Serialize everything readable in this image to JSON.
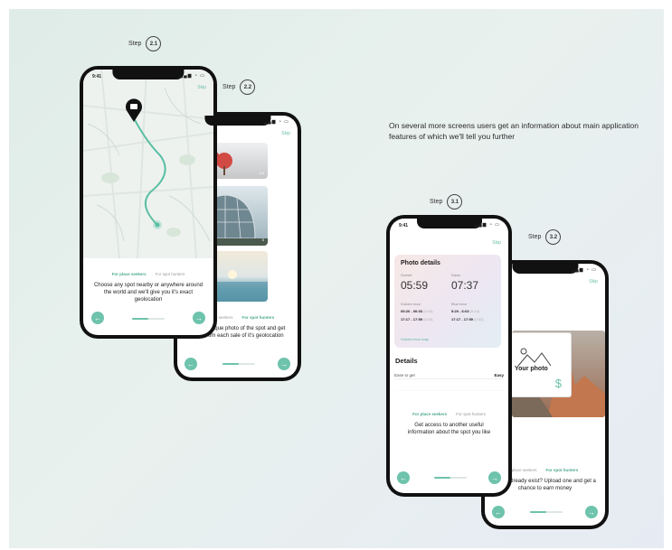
{
  "headline": "On several more screens users get an information about main application features of which we'll tell you further",
  "steps": {
    "s21": {
      "word": "Step",
      "num": "2.1"
    },
    "s22": {
      "word": "Step",
      "num": "2.2"
    },
    "s31": {
      "word": "Step",
      "num": "3.1"
    },
    "s32": {
      "word": "Step",
      "num": "3.2"
    }
  },
  "phone_a": {
    "time": "9:41",
    "skip": "Skip",
    "tab_active": "For place seekers",
    "tab_other": "For spot hunters",
    "text": "Choose any spot nearby or anywhere around the world and we'll give you it's exact geolocation"
  },
  "phone_b": {
    "skip": "Skip",
    "photo_count": "2.4",
    "photo2_count": "5",
    "tab_other": "For place seekers",
    "tab_active": "For spot hunters",
    "text": "upload unique photo of the spot and get profit from each sale of it's geolocation"
  },
  "phone_c": {
    "time": "9:41",
    "skip": "Skip",
    "card_title": "Photo details",
    "sunset_label": "Sunset",
    "sunset_time": "05:59",
    "dawn_label": "Dawn",
    "dawn_time": "07:37",
    "golden_label": "Golden hour",
    "golden_1": "05:20 - 06:03",
    "golden_1_dur": "(0:43)",
    "golden_2": "17:17 - 17:59",
    "golden_2_dur": "(0:43)",
    "blue_label": "Blue hour",
    "blue_1": "5:20 - 6:03",
    "blue_1_dur": "(0:43)",
    "blue_2": "17:17 - 17:59",
    "blue_2_dur": "(0:43)",
    "golden_map": "Golden hour map",
    "details_title": "Details",
    "row1_label": "Ease to get",
    "row1_value": "Easy",
    "tab_active": "For place seekers",
    "tab_other": "For spot hunters",
    "text": "Get access to another useful information about the spot you like"
  },
  "phone_d": {
    "skip": "Skip",
    "your_photo": "Your photo",
    "tab_other": "place seekers",
    "tab_active": "For spot hunters",
    "text": "photo already exist? Upload one and get a chance to earn money"
  },
  "colors": {
    "accent": "#6ec3ac",
    "tab_active": "#4da88f"
  }
}
